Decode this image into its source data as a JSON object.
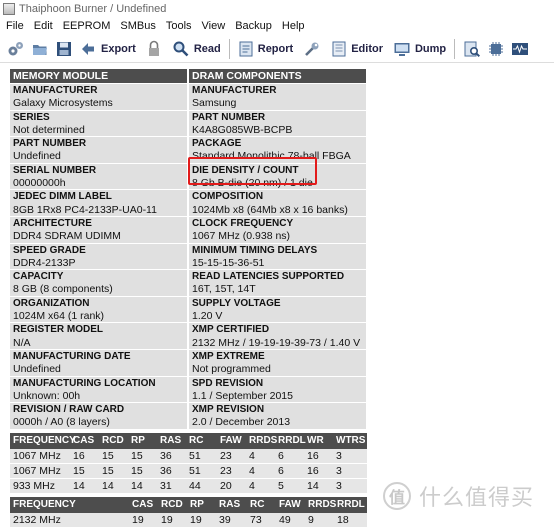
{
  "window": {
    "title": "Thaiphoon Burner / Undefined"
  },
  "menu": [
    "File",
    "Edit",
    "EEPROM",
    "SMBus",
    "Tools",
    "View",
    "Backup",
    "Help"
  ],
  "toolbar": {
    "export": "Export",
    "read": "Read",
    "report": "Report",
    "editor": "Editor",
    "dump": "Dump"
  },
  "left_header": "MEMORY MODULE",
  "right_header": "DRAM COMPONENTS",
  "rows": [
    {
      "left": {
        "k": "MANUFACTURER",
        "v": "Galaxy Microsystems"
      },
      "right": {
        "k": "MANUFACTURER",
        "v": "Samsung"
      }
    },
    {
      "left": {
        "k": "SERIES",
        "v": "Not determined"
      },
      "right": {
        "k": "PART NUMBER",
        "v": "K4A8G085WB-BCPB"
      }
    },
    {
      "left": {
        "k": "PART NUMBER",
        "v": "Undefined"
      },
      "right": {
        "k": "PACKAGE",
        "v": "Standard Monolithic 78-ball FBGA"
      }
    },
    {
      "left": {
        "k": "SERIAL NUMBER",
        "v": "00000000h"
      },
      "right": {
        "k": "DIE DENSITY / COUNT",
        "v": "8 Gb B-die (20 nm) / 1 die"
      }
    },
    {
      "left": {
        "k": "JEDEC DIMM LABEL",
        "v": "8GB 1Rx8 PC4-2133P-UA0-11"
      },
      "right": {
        "k": "COMPOSITION",
        "v": "1024Mb x8 (64Mb x8 x 16 banks)"
      }
    },
    {
      "left": {
        "k": "ARCHITECTURE",
        "v": "DDR4 SDRAM UDIMM"
      },
      "right": {
        "k": "CLOCK FREQUENCY",
        "v": "1067 MHz (0.938 ns)"
      }
    },
    {
      "left": {
        "k": "SPEED GRADE",
        "v": "DDR4-2133P"
      },
      "right": {
        "k": "MINIMUM TIMING DELAYS",
        "v": "15-15-15-36-51"
      }
    },
    {
      "left": {
        "k": "CAPACITY",
        "v": "8 GB (8 components)"
      },
      "right": {
        "k": "READ LATENCIES SUPPORTED",
        "v": "16T, 15T, 14T"
      }
    },
    {
      "left": {
        "k": "ORGANIZATION",
        "v": "1024M x64 (1 rank)"
      },
      "right": {
        "k": "SUPPLY VOLTAGE",
        "v": "1.20 V"
      }
    },
    {
      "left": {
        "k": "REGISTER MODEL",
        "v": "N/A"
      },
      "right": {
        "k": "XMP CERTIFIED",
        "v": "2132 MHz / 19-19-19-39-73 / 1.40 V"
      }
    },
    {
      "left": {
        "k": "MANUFACTURING DATE",
        "v": "Undefined"
      },
      "right": {
        "k": "XMP EXTREME",
        "v": "Not programmed"
      }
    },
    {
      "left": {
        "k": "MANUFACTURING LOCATION",
        "v": "Unknown: 00h"
      },
      "right": {
        "k": "SPD REVISION",
        "v": "1.1 / September 2015"
      }
    },
    {
      "left": {
        "k": "REVISION / RAW CARD",
        "v": "0000h / A0 (8 layers)"
      },
      "right": {
        "k": "XMP REVISION",
        "v": "2.0 / December 2013"
      }
    }
  ],
  "timing1": {
    "headers": [
      "FREQUENCY",
      "CAS",
      "RCD",
      "RP",
      "RAS",
      "RC",
      "FAW",
      "RRDS",
      "RRDL",
      "WR",
      "WTRS"
    ],
    "rows": [
      [
        "1067 MHz",
        "16",
        "15",
        "15",
        "36",
        "51",
        "23",
        "4",
        "6",
        "16",
        "3"
      ],
      [
        "1067 MHz",
        "15",
        "15",
        "15",
        "36",
        "51",
        "23",
        "4",
        "6",
        "16",
        "3"
      ],
      [
        "933 MHz",
        "14",
        "14",
        "14",
        "31",
        "44",
        "20",
        "4",
        "5",
        "14",
        "3"
      ]
    ]
  },
  "timing2": {
    "headers": [
      "FREQUENCY",
      "",
      "CAS",
      "RCD",
      "RP",
      "RAS",
      "RC",
      "FAW",
      "RRDS",
      "RRDL"
    ],
    "rows": [
      [
        "2132 MHz",
        "",
        "19",
        "19",
        "19",
        "39",
        "73",
        "49",
        "9",
        "18"
      ]
    ]
  },
  "watermark": {
    "text": "什么值得买",
    "mark": "值"
  }
}
